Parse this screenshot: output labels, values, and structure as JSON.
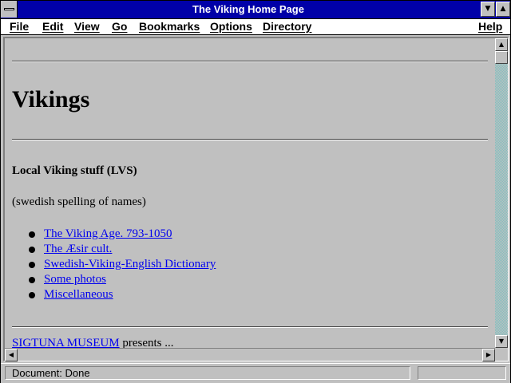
{
  "window": {
    "title": "The Viking Home Page"
  },
  "menu": {
    "file": "File",
    "edit": "Edit",
    "view": "View",
    "go": "Go",
    "bookmarks": "Bookmarks",
    "options": "Options",
    "directory": "Directory",
    "help": "Help"
  },
  "page": {
    "heading": "Vikings",
    "subtitle": "Local Viking stuff (LVS)",
    "note": "(swedish spelling of names)",
    "links": [
      "The Viking Age. 793-1050",
      "The Æsir cult.",
      "Swedish-Viking-English Dictionary",
      "Some photos",
      "Miscellaneous"
    ],
    "footer_link": "SIGTUNA MUSEUM",
    "footer_text": " presents ..."
  },
  "status": {
    "text": "Document: Done"
  },
  "colors": {
    "titlebar": "#0000a8",
    "link": "#0000ee",
    "background": "#c0c0c0"
  },
  "icons": {
    "system_menu": "system-menu-icon",
    "minimize": "minimize-icon",
    "maximize": "maximize-icon",
    "scroll_up": "arrow-up-icon",
    "scroll_down": "arrow-down-icon",
    "scroll_left": "arrow-left-icon",
    "scroll_right": "arrow-right-icon"
  }
}
